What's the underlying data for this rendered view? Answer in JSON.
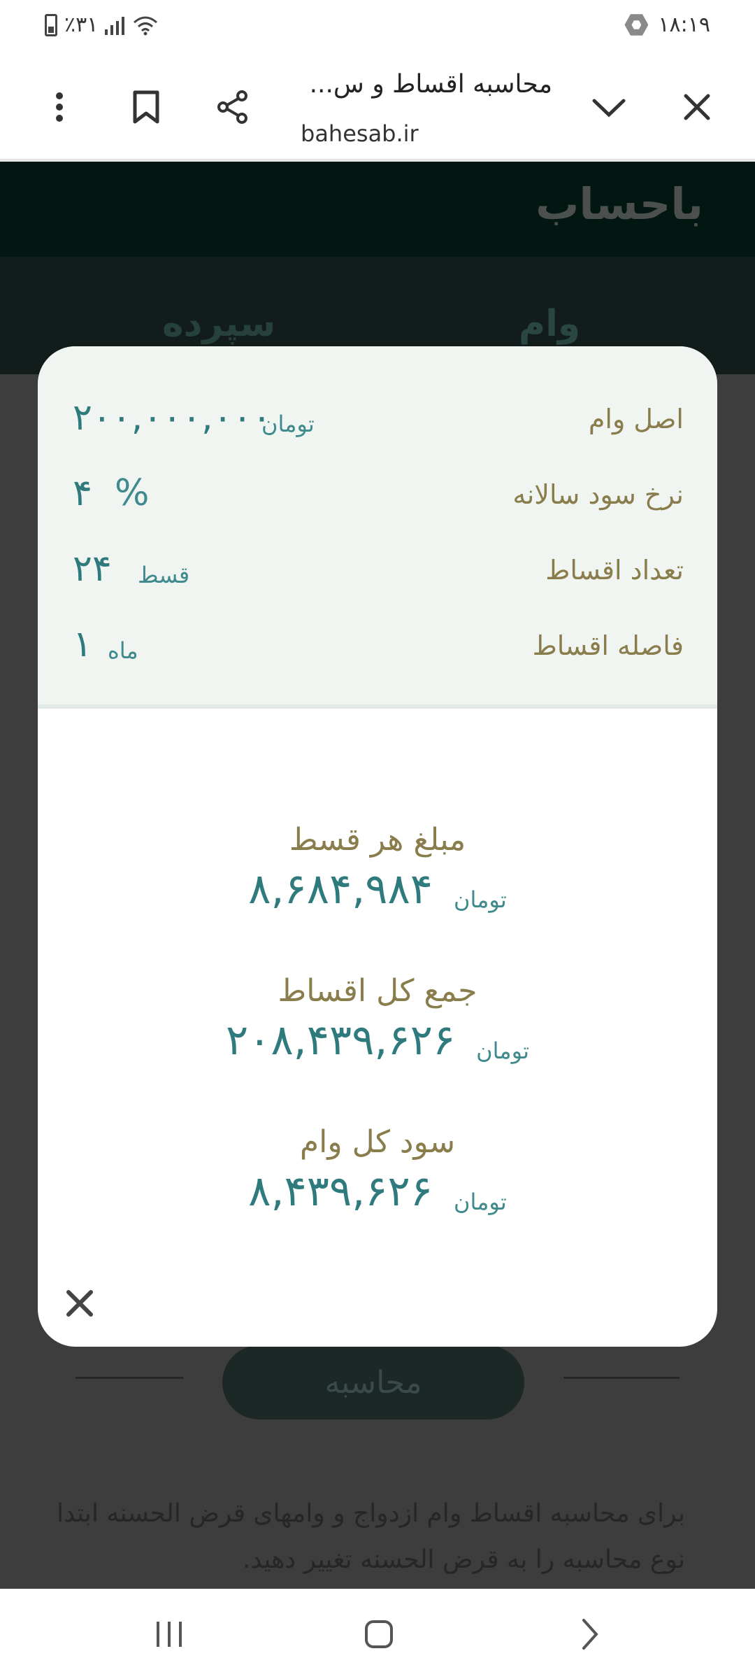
{
  "status_bar": {
    "time": "۱۸:۱۹",
    "battery": "٪۳۱"
  },
  "browser": {
    "title": "محاسبه اقساط و س...",
    "url": "bahesab.ir"
  },
  "site": {
    "logo": "باحساب",
    "tabs": [
      "وام",
      "سپرده"
    ],
    "calculate_label": "محاسبه",
    "description": "برای محاسبه اقساط وام ازدواج و وامهای قرض الحسنه ابتدا نوع محاسبه را به قرض الحسنه تغییر دهید."
  },
  "modal": {
    "summary": [
      {
        "label": "اصل وام",
        "value": "۲۰۰,۰۰۰,۰۰۰",
        "unit": "تومان"
      },
      {
        "label": "نرخ سود سالانه",
        "value": "۴",
        "unit": "%"
      },
      {
        "label": "تعداد اقساط",
        "value": "۲۴",
        "unit": "قسط"
      },
      {
        "label": "فاصله اقساط",
        "value": "۱",
        "unit": "ماه"
      }
    ],
    "results": [
      {
        "label": "مبلغ هر قسط",
        "value": "۸,۶۸۴,۹۸۴",
        "unit": "تومان"
      },
      {
        "label": "جمع کل اقساط",
        "value": "۲۰۸,۴۳۹,۶۲۶",
        "unit": "تومان"
      },
      {
        "label": "سود کل وام",
        "value": "۸,۴۳۹,۶۲۶",
        "unit": "تومان"
      }
    ]
  },
  "colors": {
    "accent_teal": "#2f7a7c",
    "label_olive": "#8a7d4c",
    "summary_bg": "#f1f5f2"
  }
}
